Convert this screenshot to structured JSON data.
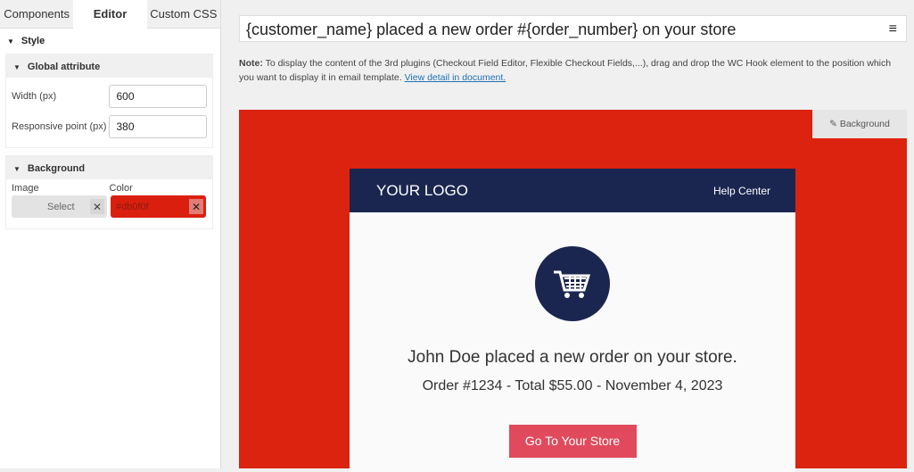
{
  "tabs": [
    {
      "label": "Components"
    },
    {
      "label": "Editor"
    },
    {
      "label": "Custom CSS"
    }
  ],
  "style": {
    "title": "Style",
    "global": {
      "title": "Global attribute",
      "width_label": "Width (px)",
      "width_value": "600",
      "resp_label": "Responsive point (px)",
      "resp_value": "380"
    },
    "background": {
      "title": "Background",
      "image_label": "Image",
      "color_label": "Color",
      "select_label": "Select",
      "color_value": "#db0f0f"
    }
  },
  "subject": "{customer_name} placed a new order #{order_number} on your store",
  "note": {
    "bold": "Note:",
    "text": " To display the content of the 3rd plugins (Checkout Field Editor, Flexible Checkout Fields,...), drag and drop the WC Hook element to the position which you want to display it in email template. ",
    "link": "View detail in document."
  },
  "canvas": {
    "bg_button": "Background",
    "bg_color": "#db230f"
  },
  "email": {
    "logo": "YOUR LOGO",
    "help": "Help Center",
    "heading": "John Doe placed a new order on your store.",
    "summary": "Order #1234 - Total $55.00 - November 4, 2023",
    "cta": "Go To Your Store"
  }
}
